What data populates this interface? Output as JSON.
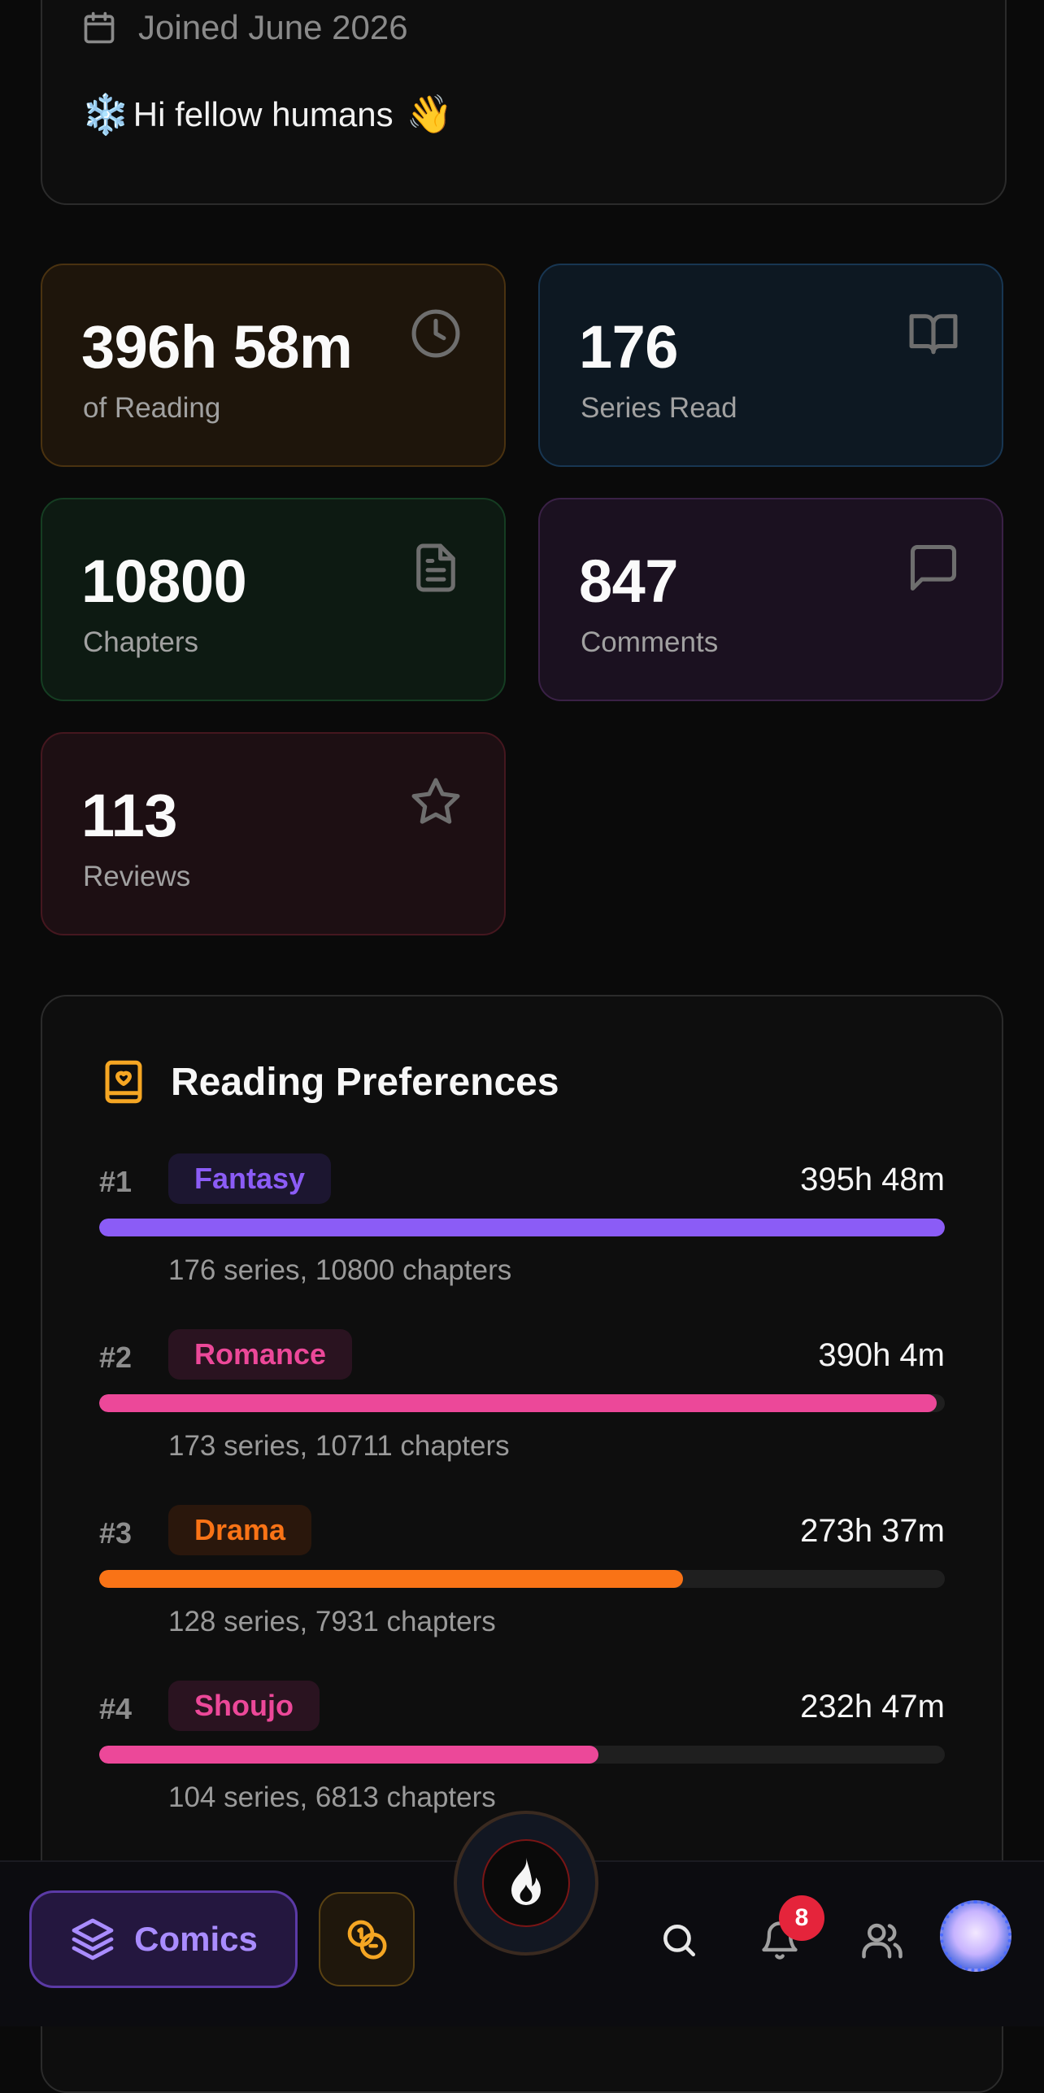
{
  "profile": {
    "joined": "Joined June 2026",
    "bio": "Hi fellow humans",
    "bio_emoji_lead": "❄️",
    "bio_emoji_trail": "👋"
  },
  "stats": [
    {
      "value": "396h 58m",
      "label": "of Reading",
      "icon": "clock-icon"
    },
    {
      "value": "176",
      "label": "Series Read",
      "icon": "book-open-icon"
    },
    {
      "value": "10800",
      "label": "Chapters",
      "icon": "document-icon"
    },
    {
      "value": "847",
      "label": "Comments",
      "icon": "chat-bubble-icon"
    },
    {
      "value": "113",
      "label": "Reviews",
      "icon": "star-icon"
    }
  ],
  "preferences": {
    "title": "Reading Preferences",
    "items": [
      {
        "rank": "#1",
        "genre": "Fantasy",
        "hours": "395h 48m",
        "meta": "176 series, 10800 chapters",
        "fraction": 1.0,
        "color": "#8b5cf6"
      },
      {
        "rank": "#2",
        "genre": "Romance",
        "hours": "390h 4m",
        "meta": "173 series, 10711 chapters",
        "fraction": 0.99,
        "color": "#ec4899"
      },
      {
        "rank": "#3",
        "genre": "Drama",
        "hours": "273h 37m",
        "meta": "128 series, 7931 chapters",
        "fraction": 0.69,
        "color": "#f97316"
      },
      {
        "rank": "#4",
        "genre": "Shoujo",
        "hours": "232h 47m",
        "meta": "104 series, 6813 chapters",
        "fraction": 0.59,
        "color": "#ec4899"
      }
    ]
  },
  "nav": {
    "comics_label": "Comics",
    "notification_count": "8"
  },
  "colors": {
    "accent_purple": "#a98cff",
    "accent_orange": "#f5a623",
    "badge_red": "#e5243b"
  }
}
